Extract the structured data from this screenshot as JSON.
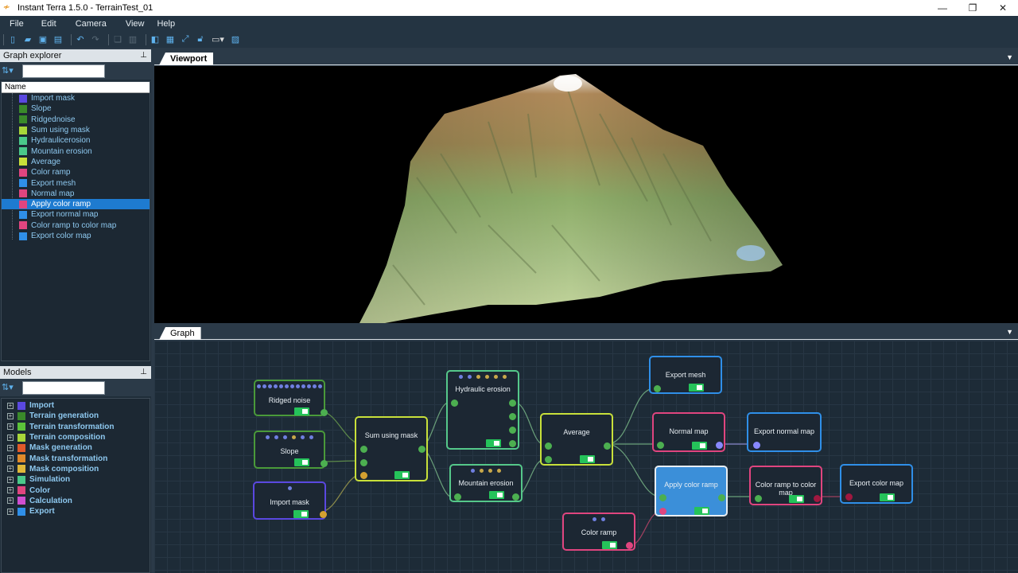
{
  "window": {
    "title": "Instant Terra 1.5.0 - TerrainTest_01",
    "logo": "instant-terra-logo"
  },
  "menu": [
    "File",
    "Edit",
    "Camera",
    "View",
    "Help"
  ],
  "graph_explorer": {
    "title": "Graph explorer",
    "column": "Name",
    "items": [
      {
        "label": "Import mask",
        "color": "#5a48e0"
      },
      {
        "label": "Slope",
        "color": "#3a8a2a"
      },
      {
        "label": "Ridgednoise",
        "color": "#3a8a2a"
      },
      {
        "label": "Sum using mask",
        "color": "#a8d63a"
      },
      {
        "label": "Hydraulicerosion",
        "color": "#4ac98a"
      },
      {
        "label": "Mountain erosion",
        "color": "#4ac98a"
      },
      {
        "label": "Average",
        "color": "#c8e03a"
      },
      {
        "label": "Color ramp",
        "color": "#e0457f"
      },
      {
        "label": "Export mesh",
        "color": "#2f8fe8"
      },
      {
        "label": "Normal map",
        "color": "#e0457f"
      },
      {
        "label": "Apply color ramp",
        "color": "#e0457f",
        "selected": true
      },
      {
        "label": "Export normal map",
        "color": "#2f8fe8"
      },
      {
        "label": "Color ramp to color map",
        "color": "#e0457f"
      },
      {
        "label": "Export color map",
        "color": "#2f8fe8"
      }
    ]
  },
  "models": {
    "title": "Models",
    "items": [
      {
        "label": "Import",
        "color": "#5a48e0"
      },
      {
        "label": "Terrain generation",
        "color": "#3a8a2a"
      },
      {
        "label": "Terrain transformation",
        "color": "#5cc33a"
      },
      {
        "label": "Terrain composition",
        "color": "#a8d63a"
      },
      {
        "label": "Mask generation",
        "color": "#e05a2a"
      },
      {
        "label": "Mask transformation",
        "color": "#e08a2a"
      },
      {
        "label": "Mask composition",
        "color": "#e0b83a"
      },
      {
        "label": "Simulation",
        "color": "#4ac98a"
      },
      {
        "label": "Color",
        "color": "#e0457f"
      },
      {
        "label": "Calculation",
        "color": "#d04fd0"
      },
      {
        "label": "Export",
        "color": "#2f8fe8"
      }
    ]
  },
  "tabs": {
    "viewport": "Viewport",
    "graph": "Graph"
  },
  "nodes": {
    "ridged": "Ridged noise",
    "slope": "Slope",
    "importmask": "Import mask",
    "sum": "Sum using mask",
    "hydraulic": "Hydraulic erosion",
    "mountain": "Mountain erosion",
    "average": "Average",
    "exportmesh": "Export mesh",
    "normal": "Normal map",
    "exportnormal": "Export normal map",
    "apply": "Apply color ramp",
    "ramp2map": "Color ramp to color map",
    "exportcolor": "Export color map",
    "colorramp": "Color ramp"
  }
}
